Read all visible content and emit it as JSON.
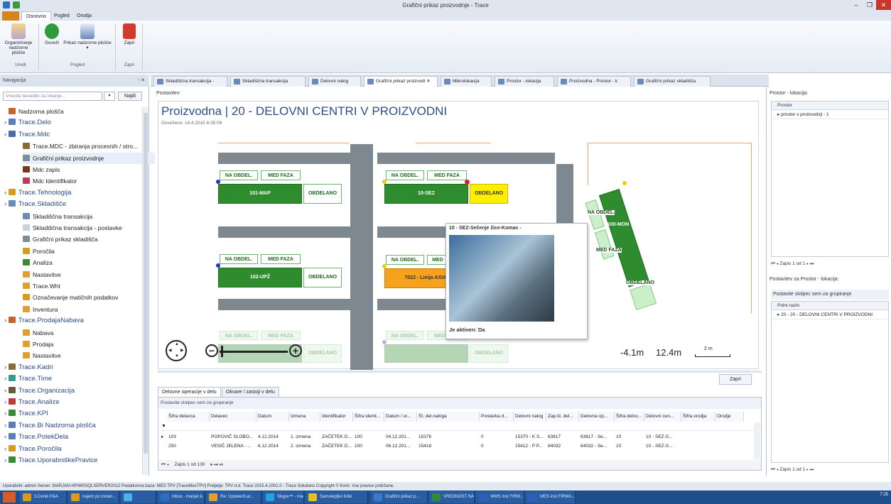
{
  "window": {
    "title": "Grafični prikaz proizvodnje - Trace"
  },
  "ribbon": {
    "tabs": [
      "Osnovno",
      "Pogled",
      "Orodja"
    ],
    "buttons": [
      {
        "label": "Organiziranje nadzorne plošče",
        "icon": "dashboard-icon"
      },
      {
        "label": "Osveži",
        "icon": "refresh-icon"
      },
      {
        "label": "Prikaz nadzorne plošče",
        "icon": "dashboard-view-icon"
      },
      {
        "label": "Zapri",
        "icon": "close-icon"
      }
    ],
    "groups": [
      "Uredi",
      "Pogled",
      "Zapri"
    ]
  },
  "navigation": {
    "title": "Navigacija",
    "search_placeholder": "Vnesite besedilo za iskanje...",
    "search_button": "Najdi",
    "items": [
      {
        "label": "Nadzorna plošča",
        "level": 1,
        "icon_color": "#c8642a"
      },
      {
        "label": "Trace.Delo",
        "level": 0,
        "icon_color": "#5a7fb8"
      },
      {
        "label": "Trace.Mdc",
        "level": 0,
        "icon_color": "#4a6fa5"
      },
      {
        "label": "Trace.MDC - zbiranja procesnih / stro...",
        "level": 2,
        "icon_color": "#8c6a3a"
      },
      {
        "label": "Grafični prikaz proizvodnje",
        "level": 2,
        "icon_color": "#7d8da0"
      },
      {
        "label": "Mdc zapis",
        "level": 2,
        "icon_color": "#7a3a1a"
      },
      {
        "label": "Mdc Identifikator",
        "level": 2,
        "icon_color": "#c03a5a"
      },
      {
        "label": "Trace.Tehnologija",
        "level": 0,
        "icon_color": "#d99a20"
      },
      {
        "label": "Trace.Skladišče",
        "level": 0,
        "icon_color": "#6a8ab8"
      },
      {
        "label": "Skladiščna transakcija",
        "level": 2,
        "icon_color": "#6a8ab8"
      },
      {
        "label": "Skladiščna transakcija - postavke",
        "level": 2,
        "icon_color": "#c9d2de"
      },
      {
        "label": "Grafični prikaz skladišča",
        "level": 2,
        "icon_color": "#7d8da0"
      },
      {
        "label": "Poročila",
        "level": 2,
        "icon_color": "#d99a20"
      },
      {
        "label": "Analiza",
        "level": 2,
        "icon_color": "#3a8a3a"
      },
      {
        "label": "Nastavitve",
        "level": 2,
        "icon_color": "#e0a030"
      },
      {
        "label": "Trace.Wht",
        "level": 2,
        "icon_color": "#e0a030"
      },
      {
        "label": "Označevanje matičnih podatkov",
        "level": 2,
        "icon_color": "#d99a20"
      },
      {
        "label": "Inventura",
        "level": 2,
        "icon_color": "#e0a030"
      },
      {
        "label": "Trace.ProdajaNabava",
        "level": 0,
        "icon_color": "#c8642a"
      },
      {
        "label": "Nabava",
        "level": 2,
        "icon_color": "#e0a030"
      },
      {
        "label": "Prodaja",
        "level": 2,
        "icon_color": "#e0a030"
      },
      {
        "label": "Nastavitve",
        "level": 2,
        "icon_color": "#e0a030"
      },
      {
        "label": "Trace.Kadri",
        "level": 0,
        "icon_color": "#8c6a3a"
      },
      {
        "label": "Trace.Time",
        "level": 0,
        "icon_color": "#3a9a8a"
      },
      {
        "label": "Trace.Organizacija",
        "level": 0,
        "icon_color": "#6a5a3a"
      },
      {
        "label": "Trace.Analize",
        "level": 0,
        "icon_color": "#c03a3a"
      },
      {
        "label": "Trace.KPI",
        "level": 0,
        "icon_color": "#3a8a3a"
      },
      {
        "label": "Trace.Bi Nadzorna plošča",
        "level": 0,
        "icon_color": "#5a7fb8"
      },
      {
        "label": "Trace.PotekDela",
        "level": 0,
        "icon_color": "#5a7fb8"
      },
      {
        "label": "Trace.Poročila",
        "level": 0,
        "icon_color": "#d99a20"
      },
      {
        "label": "Trace.UporabniškePravice",
        "level": 0,
        "icon_color": "#3a8a3a"
      }
    ]
  },
  "doc_tabs": [
    {
      "label": "Skladiščna transakcija -",
      "active": false
    },
    {
      "label": "Skladiščna transakcija",
      "active": false
    },
    {
      "label": "Delovni nalog",
      "active": false
    },
    {
      "label": "Grafični prikaz proizvodi",
      "active": true
    },
    {
      "label": "Mikrolokacija",
      "active": false
    },
    {
      "label": "Prostor - lokacija",
      "active": false
    },
    {
      "label": "Proizvodna - Prostor - k",
      "active": false
    },
    {
      "label": "Grafični prikaz skladišča",
      "active": false
    }
  ],
  "main": {
    "postavitev": "Postavitev:",
    "heading": "Proizvodna | 20 - DELOVNI CENTRI V PROIZVODNI",
    "updated": "Osveženo: 14.4.2015 6:35:09",
    "workcenters": [
      {
        "tag1": "NA OBDEL.",
        "tag2": "MED FAZA",
        "name": "101-MAP",
        "status": "OBDELANO",
        "color": "green"
      },
      {
        "tag1": "NA OBDEL.",
        "tag2": "MED FAZA",
        "name": "10-SEZ",
        "status": "OBDELANO",
        "color": "green"
      },
      {
        "tag1": "NA OBDEL.",
        "tag2": "MED FAZA",
        "name": "102-UPŽ",
        "status": "OBDELANO",
        "color": "green"
      },
      {
        "tag1": "NA OBDEL.",
        "tag2": "MED FAZA",
        "name": "7022 - Linija AXIA",
        "status": "",
        "color": "orange"
      },
      {
        "tag1": "NA OBDEL.",
        "tag2": "MED FAZA",
        "name": "",
        "status": "",
        "color": "light"
      },
      {
        "tag1": "NA OBDEL.",
        "tag2": "MED FAZA",
        "name": "",
        "status": "",
        "color": "light"
      },
      {
        "tag1": "NA OBDEL.",
        "tag2": "MED FAZA",
        "name": "100-MON",
        "status": "OBDELANO",
        "color": "green"
      }
    ],
    "extra_labels": [
      "10",
      "OBDELANO",
      "OBDELANO"
    ],
    "popup": {
      "title": "10 - SEZ-Sečenje žice-Komax -",
      "active": "Je aktiven: Da"
    },
    "measure": {
      "a": "-4.1m",
      "b": "12.4m",
      "scale": "2 m"
    },
    "close_button": "Zapri"
  },
  "bottom": {
    "tabs": [
      {
        "label": "Delovne operacije v delu",
        "active": true
      },
      {
        "label": "Okvare / zastoji v delu",
        "active": false
      }
    ],
    "group_hint": "Postavite stolpec sem za grupiranje",
    "columns": [
      "Šifra delavca",
      "Delavec",
      "Datum",
      "Izmena",
      "Identifikator",
      "Šifra identi...",
      "Datum / ur...",
      "Št. del.naloga",
      "Postavka d...",
      "Delovni nalog",
      "Zap.št. del...",
      "Delovna op...",
      "Šifra delov...",
      "Delovni cen...",
      "Šifra orodja",
      "Orodje"
    ],
    "rows": [
      [
        "103",
        "POPOVIČ SLOBO...",
        "4.12.2014",
        "1. izmena",
        "ZAČETEK D...",
        "100",
        "04.12.201...",
        "15376",
        "0",
        "15370 - K S...",
        "63817",
        "63817 - Se...",
        "10",
        "10 - SEZ-S...",
        "",
        ""
      ],
      [
        "250",
        "VESIČ JELENA - ...",
        "6.12.2014",
        "2. izmena",
        "ZAČETEK D...",
        "100",
        "06.12.201...",
        "15418",
        "0",
        "15412 - P P...",
        "64032",
        "64032 - Se...",
        "10",
        "10 - SEZ-S...",
        "",
        ""
      ]
    ],
    "pager": "Zapis 1 od 130"
  },
  "right": {
    "title1": "Prostor - lokacija:",
    "col1": "Prostor",
    "rows1": [
      "prostor v proizvodnji - 1"
    ],
    "pager1": "Zapis 1 od 1",
    "title2": "Postavitev za Prostor - lokacija:",
    "group_hint": "Postavite stolpec sem za grupiranje",
    "col2": "Polni naziv",
    "rows2": [
      "20 - 20 - DELOVNI CENTRI V PROIZVODNI"
    ],
    "pager2": "Zapis 1 od 1"
  },
  "statusbar": "Uporabnik: admin  Server: MARJAN-HP\\MSSQLSERVER2012  Podatkovna baza: MES TPV [TraceMesTPV]  Podjetje: TPV d.d.      Trace 2015.4.1001.0 - Trace Solutions Copyright © Kvint. Vse pravice pridržane.",
  "taskbar": {
    "items": [
      "3.Cenik P&A",
      "najem po instan...",
      "",
      "Inbox - marjan.k...",
      "Re: Update//Lar...",
      "Skype™ - marja...",
      "Samolepljivi listki",
      "Grafični prikaz p...",
      "VREDNOST NAJ...",
      "WMS inst FIRM...",
      "MES inst FIRMA..."
    ],
    "time": "7:25"
  },
  "colors": {
    "accent": "#2c4f86",
    "green": "#2e8b2e",
    "yellow": "#ffee00",
    "orange": "#f7a21c",
    "wall": "#7d8891"
  }
}
